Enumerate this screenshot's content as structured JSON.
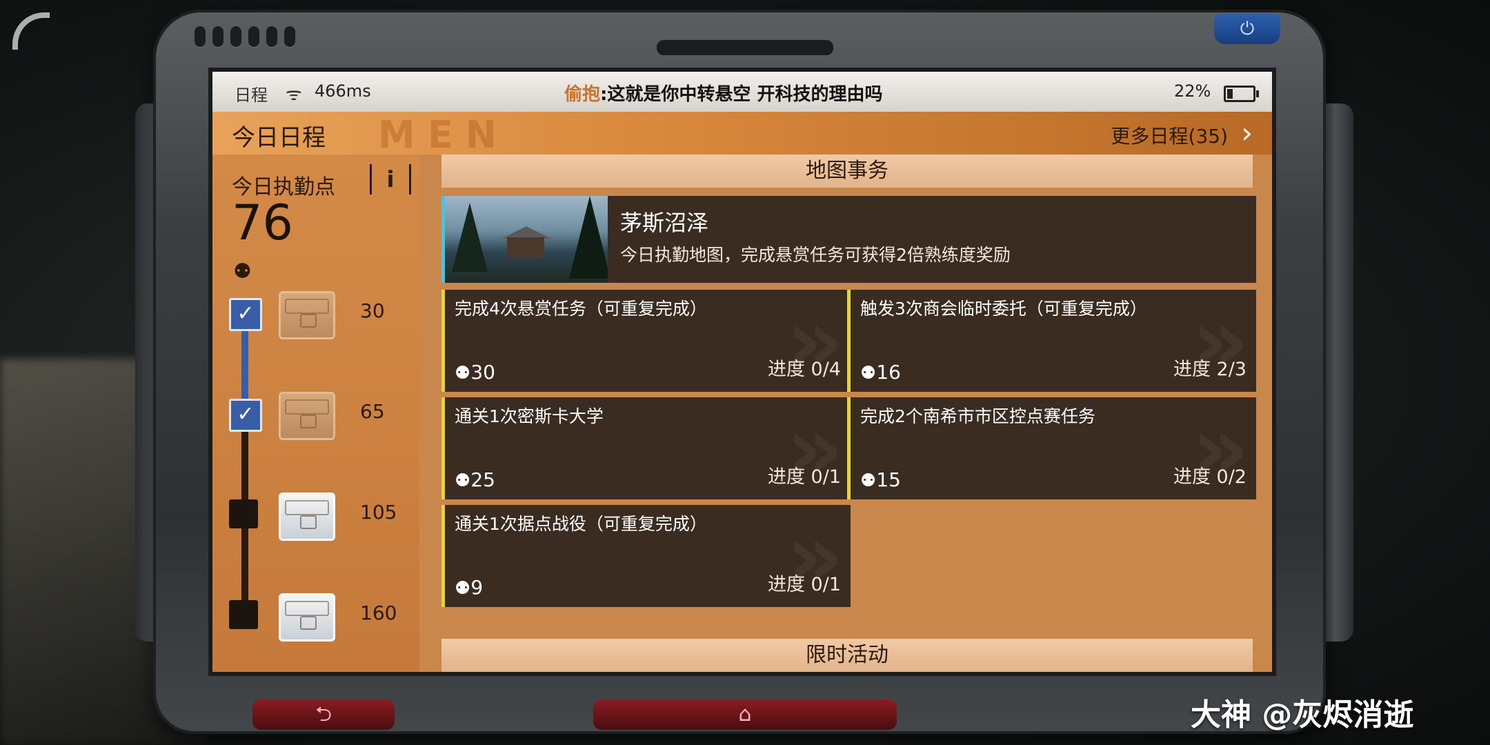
{
  "status_bar": {
    "schedule_label": "日程",
    "wifi_icon": "wifi-icon",
    "ping": "466ms",
    "chat_sender": "偷抱",
    "chat_message": ":这就是你中转悬空 开科技的理由吗",
    "battery_percent": "22%",
    "battery_level": 0.22
  },
  "header": {
    "title": "今日日程",
    "decor_text": "MEN",
    "more_label": "更多日程(35)",
    "more_icon": "chevron-right-icon"
  },
  "duty": {
    "label": "今日执勤点",
    "info_label": "i",
    "value": "76",
    "icon": "duty-point-icon",
    "milestones": [
      {
        "value": "30",
        "completed": true,
        "chest": "opened"
      },
      {
        "value": "65",
        "completed": true,
        "chest": "opened"
      },
      {
        "value": "105",
        "completed": false,
        "chest": "closed"
      },
      {
        "value": "160",
        "completed": false,
        "chest": "closed"
      }
    ]
  },
  "map_section": {
    "heading": "地图事务",
    "map": {
      "name": "茅斯沼泽",
      "description": "今日执勤地图，完成悬赏任务可获得2倍熟练度奖励"
    },
    "tasks": [
      {
        "title": "完成4次悬赏任务（可重复完成）",
        "reward": "30",
        "progress": "进度 0/4"
      },
      {
        "title": "触发3次商会临时委托（可重复完成）",
        "reward": "16",
        "progress": "进度 2/3"
      },
      {
        "title": "通关1次密斯卡大学",
        "reward": "25",
        "progress": "进度 0/1"
      },
      {
        "title": "完成2个南希市市区控点赛任务",
        "reward": "15",
        "progress": "进度 0/2"
      },
      {
        "title": "通关1次据点战役（可重复完成）",
        "reward": "9",
        "progress": "进度 0/1"
      }
    ]
  },
  "limited_section": {
    "heading": "限时活动"
  },
  "device": {
    "power_icon": "power-icon",
    "back_icon": "back-icon",
    "home_icon": "home-icon"
  },
  "watermark": "大神 @灰烬消逝",
  "colors": {
    "accent_orange": "#d98a3e",
    "card_bg": "#3a2c20",
    "task_border": "#e6d23e",
    "map_border": "#4ec3e0",
    "check_blue": "#3a5da8"
  }
}
